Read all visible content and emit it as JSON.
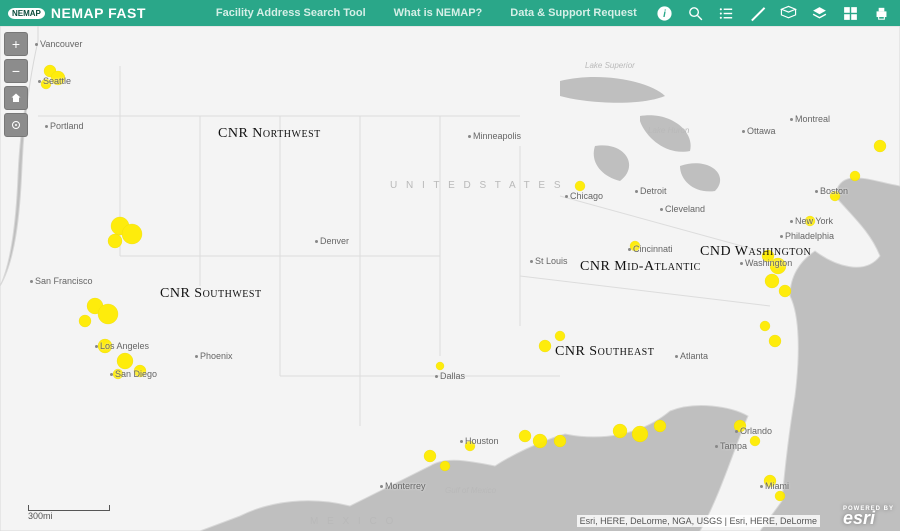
{
  "header": {
    "logo_badge": "NEMAP",
    "title": "NEMAP FAST",
    "links": {
      "fast": "Facility Address Search Tool",
      "what": "What is NEMAP?",
      "support": "Data & Support Request"
    },
    "tools": [
      "info-icon",
      "search-icon",
      "list-icon",
      "measure-icon",
      "bookmark-icon",
      "layers-icon",
      "basemap-icon",
      "print-icon"
    ]
  },
  "controls": {
    "zoom_in": "+",
    "zoom_out": "−"
  },
  "regions": {
    "nw": "CNR Northwest",
    "sw": "CNR Southwest",
    "se": "CNR Southeast",
    "ma": "CNR Mid-Atlantic",
    "dw": "CND Washington"
  },
  "cities": {
    "vancouver": "Vancouver",
    "seattle": "Seattle",
    "portland": "Portland",
    "sanfran": "San Francisco",
    "la": "Los Angeles",
    "sandiego": "San Diego",
    "phoenix": "Phoenix",
    "denver": "Denver",
    "minneapolis": "Minneapolis",
    "chicago": "Chicago",
    "stlouis": "St Louis",
    "dallas": "Dallas",
    "houston": "Houston",
    "monterrey": "Monterrey",
    "detroit": "Detroit",
    "cleveland": "Cleveland",
    "cincinnati": "Cincinnati",
    "atlanta": "Atlanta",
    "orlando": "Orlando",
    "tampa": "Tampa",
    "miami": "Miami",
    "washington": "Washington",
    "philadelphia": "Philadelphia",
    "newyork": "New York",
    "boston": "Boston",
    "montreal": "Montreal",
    "ottawa": "Ottawa"
  },
  "lakes": {
    "superior": "Lake Superior",
    "huron": "Lake Huron",
    "gulf": "Gulf of Mexico"
  },
  "countries": {
    "us": "U N I T E D   S T A T E S",
    "mx": "M E X I C O"
  },
  "scale": {
    "label": "300mi"
  },
  "attribution": "Esri, HERE, DeLorme, NGA, USGS | Esri, HERE, DeLorme",
  "esri": {
    "powered": "POWERED BY",
    "name": "esri"
  }
}
